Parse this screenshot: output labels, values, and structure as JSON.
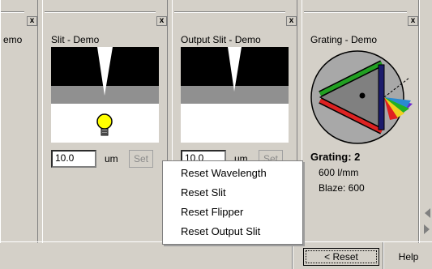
{
  "panels": {
    "left": {
      "title": "emo",
      "close": "x"
    },
    "slit": {
      "title": "Slit - Demo",
      "close": "x",
      "value": "10.0",
      "unit": "um",
      "set": "Set"
    },
    "output": {
      "title": "Output Slit - Demo",
      "close": "x",
      "value": "10.0",
      "unit": "um",
      "set": "Set"
    },
    "grating": {
      "title": "Grating - Demo",
      "close": "x",
      "label": "Grating: 2",
      "density": "600 l/mm",
      "blaze": "Blaze: 600"
    }
  },
  "menu": {
    "items": [
      "Reset Wavelength",
      "Reset Slit",
      "Reset Flipper",
      "Reset Output Slit"
    ]
  },
  "footer": {
    "reset": "< Reset",
    "help": "Help"
  },
  "colors": {
    "bulb": "#ffff00",
    "green": "#22a022",
    "red": "#dd2222",
    "navy": "#1c1c6c"
  }
}
